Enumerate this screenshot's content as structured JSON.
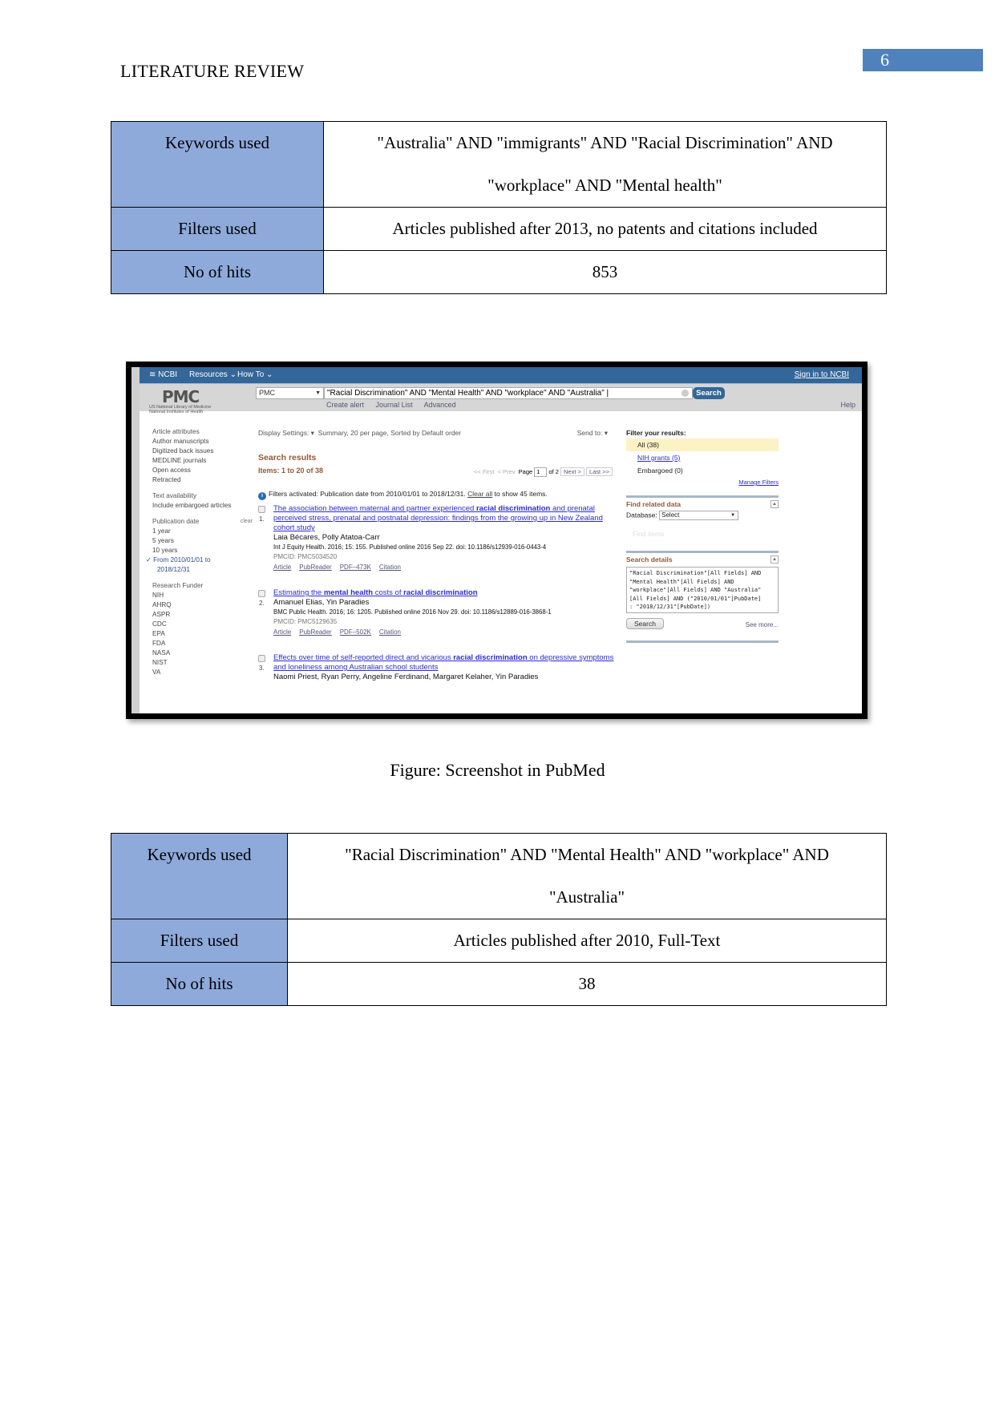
{
  "page": {
    "header_title": "LITERATURE REVIEW",
    "page_number": "6",
    "accent_color": "#4f81bd",
    "label_cell_color": "#8eaadb"
  },
  "table1": {
    "rows": [
      {
        "label": "Keywords used",
        "value_line1": "\"Australia\" AND \"immigrants\" AND \"Racial Discrimination\" AND",
        "value_line2": "\"workplace\" AND \"Mental health\""
      },
      {
        "label": "Filters used",
        "value": "Articles published after 2013, no patents and citations included"
      },
      {
        "label": "No of hits",
        "value": "853"
      }
    ]
  },
  "screenshot": {
    "ncbi_bar": {
      "logo": "NCBI",
      "resources": "Resources",
      "how_to": "How To",
      "sign_in": "Sign in to NCBI"
    },
    "search": {
      "logo": "PMC",
      "logo_sub1": "US National Library of Medicine",
      "logo_sub2": "National Institutes of Health",
      "database": "PMC",
      "query": "\"Racial Discrimination\" AND \"Mental Health\" AND \"workplace\" AND \"Australia\"",
      "button": "Search",
      "links": [
        "Create alert",
        "Journal List",
        "Advanced"
      ],
      "help": "Help"
    },
    "left_filters": {
      "article_attributes": "Article attributes",
      "attr_items": [
        "Author manuscripts",
        "Digitized back issues",
        "MEDLINE journals",
        "Open access",
        "Retracted"
      ],
      "text_availability": "Text availability",
      "text_items": [
        "Include embargoed articles"
      ],
      "publication_date": "Publication date",
      "clear": "clear",
      "date_items": [
        "1 year",
        "5 years",
        "10 years"
      ],
      "date_selected_1": "From 2010/01/01 to",
      "date_selected_2": "2018/12/31",
      "research_funder": "Research Funder",
      "funder_items": [
        "NIH",
        "AHRQ",
        "ASPR",
        "CDC",
        "EPA",
        "FDA",
        "NASA",
        "NIST",
        "VA"
      ]
    },
    "results": {
      "display_settings": "Display Settings:",
      "display_value": "Summary, 20 per page, Sorted by Default order",
      "send_to": "Send to:",
      "title": "Search results",
      "items": "Items: 1 to 20 of 38",
      "pager": {
        "first": "<< First",
        "prev": "< Prev",
        "page_label": "Page",
        "page": "1",
        "of": "of 2",
        "next": "Next >",
        "last": "Last >>"
      },
      "filters_activated": "Filters activated: Publication date from 2010/01/01 to 2018/12/31.",
      "clear_all": "Clear all",
      "show_all": "to show 45 items.",
      "list": [
        {
          "num": "1.",
          "title_a": "The association between maternal and partner experienced ",
          "title_b": "racial discrimination",
          "title_c": " and prenatal perceived stress, prenatal and postnatal depression: findings from the growing up in New Zealand cohort study",
          "authors": "Laia Bécares, Polly Atatoa-Carr",
          "citation": "Int J Equity Health. 2016; 15: 155. Published online 2016 Sep 22. doi: 10.1186/s12939-016-0443-4",
          "pmcid": "PMCID: PMC5034520",
          "links": [
            "Article",
            "PubReader",
            "PDF–473K",
            "Citation"
          ]
        },
        {
          "num": "2.",
          "title_a": "Estimating the ",
          "title_b": "mental health",
          "title_c": " costs of ",
          "title_d": "racial discrimination",
          "authors": "Amanuel Elias, Yin Paradies",
          "citation": "BMC Public Health. 2016; 16: 1205. Published online 2016 Nov 29. doi: 10.1186/s12889-016-3868-1",
          "pmcid": "PMCID: PMC5129635",
          "links": [
            "Article",
            "PubReader",
            "PDF–502K",
            "Citation"
          ]
        },
        {
          "num": "3.",
          "title_a": "Effects over time of self-reported direct and vicarious ",
          "title_b": "racial discrimination",
          "title_c": " on depressive symptoms and loneliness among Australian school students",
          "authors": "Naomi Priest, Ryan Perry, Angeline Ferdinand, Margaret Kelaher, Yin Paradies"
        }
      ]
    },
    "right_panel": {
      "filter_title": "Filter your results:",
      "filters": [
        "All (38)",
        "NIH grants (5)",
        "Embargoed (0)"
      ],
      "manage_filters": "Manage Filters",
      "find_related": "Find related data",
      "database_label": "Database:",
      "database_value": "Select",
      "find_items": "Find items",
      "search_details_title": "Search details",
      "search_details": "\"Racial Discrimination\"[All Fields] AND\n\"Mental Health\"[All Fields] AND\n\"workplace\"[All Fields] AND \"Australia\"\n[All Fields] AND (\"2010/01/01\"[PubDate]\n: \"2018/12/31\"[PubDate])",
      "search_button": "Search",
      "see_more": "See more..."
    }
  },
  "caption": "Figure: Screenshot in PubMed",
  "table2": {
    "rows": [
      {
        "label": "Keywords used",
        "value_line1": "\"Racial Discrimination\" AND \"Mental Health\" AND \"workplace\" AND",
        "value_line2": "\"Australia\""
      },
      {
        "label": "Filters used",
        "value": "Articles published after 2010, Full-Text"
      },
      {
        "label": "No of hits",
        "value": "38"
      }
    ]
  }
}
